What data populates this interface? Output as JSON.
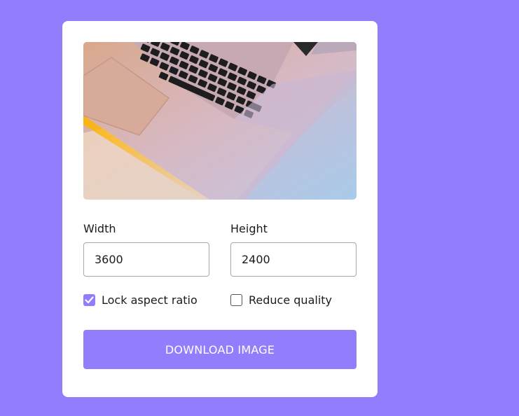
{
  "colors": {
    "page_background": "#927dfc",
    "card_background": "#ffffff",
    "accent": "#927dfc"
  },
  "preview": {
    "icon": "laptop-photo"
  },
  "width_field": {
    "label": "Width",
    "value": "3600"
  },
  "height_field": {
    "label": "Height",
    "value": "2400"
  },
  "options": {
    "lock_aspect_ratio": {
      "label": "Lock aspect ratio",
      "checked": true
    },
    "reduce_quality": {
      "label": "Reduce quality",
      "checked": false
    }
  },
  "download_button": {
    "label": "DOWNLOAD IMAGE"
  }
}
